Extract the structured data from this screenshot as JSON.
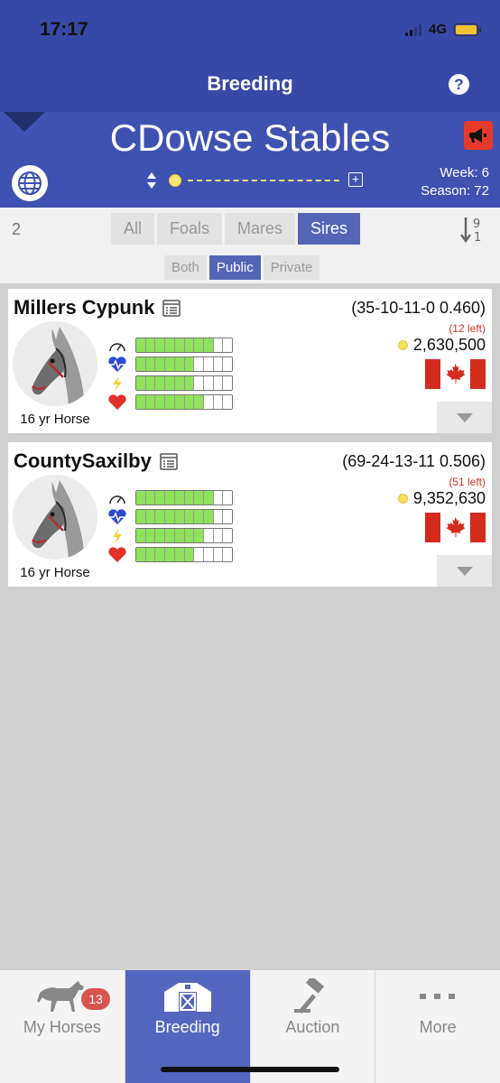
{
  "status_bar": {
    "time": "17:17",
    "network": "4G"
  },
  "nav": {
    "title": "Breeding",
    "help_icon": "question-circle-icon"
  },
  "stable": {
    "name": "CDowse Stables",
    "week_label": "Week: 6",
    "season_label": "Season: 72",
    "alert_icon": "megaphone-icon",
    "globe_icon": "globe-icon"
  },
  "filters": {
    "count": "2",
    "tabs": [
      {
        "label": "All",
        "active": false
      },
      {
        "label": "Foals",
        "active": false
      },
      {
        "label": "Mares",
        "active": false
      },
      {
        "label": "Sires",
        "active": true
      }
    ],
    "subtabs": [
      {
        "label": "Both",
        "active": false
      },
      {
        "label": "Public",
        "active": true
      },
      {
        "label": "Private",
        "active": false
      }
    ]
  },
  "horses": [
    {
      "name": "Millers Cypunk",
      "record": "(35-10-11-0 0.460)",
      "left": "(12 left)",
      "price": "2,630,500",
      "age_label": "16 yr Horse",
      "country": "Canada",
      "stats": {
        "speed": 8,
        "stamina": 6,
        "energy": 6,
        "heart": 7
      }
    },
    {
      "name": "CountySaxilby",
      "record": "(69-24-13-11 0.506)",
      "left": "(51 left)",
      "price": "9,352,630",
      "age_label": "16 yr Horse",
      "country": "Canada",
      "stats": {
        "speed": 8,
        "stamina": 8,
        "energy": 7,
        "heart": 6
      }
    }
  ],
  "stat_bar_segments": 10,
  "colors": {
    "header": "#3748a6",
    "banner": "#3f51b1",
    "active_tab": "#5465b6",
    "bar_fill": "#8ee35a",
    "alert": "#e53a2b"
  },
  "tabbar": [
    {
      "label": "My Horses",
      "icon": "horse-icon",
      "badge": "13",
      "active": false
    },
    {
      "label": "Breeding",
      "icon": "barn-icon",
      "active": true
    },
    {
      "label": "Auction",
      "icon": "gavel-icon",
      "active": false
    },
    {
      "label": "More",
      "icon": "more-dots-icon",
      "active": false
    }
  ]
}
